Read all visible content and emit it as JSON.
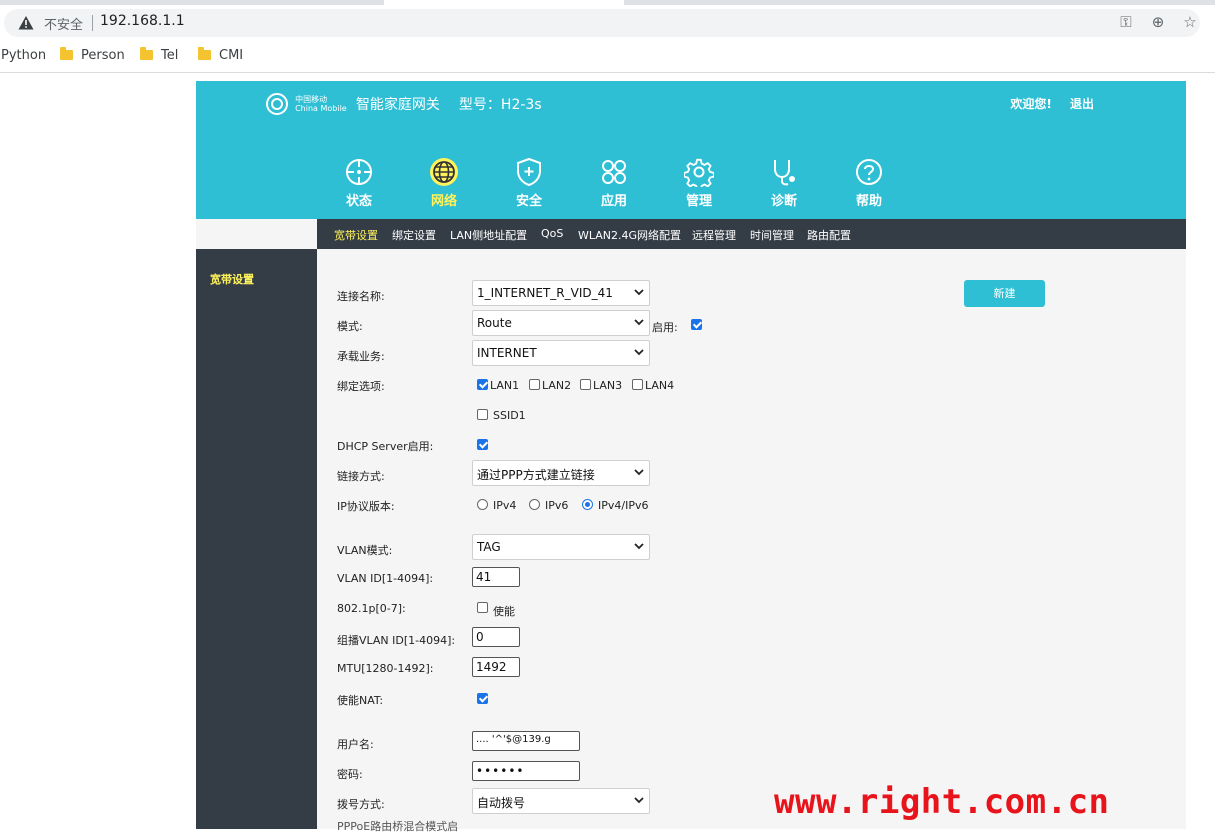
{
  "browser": {
    "security_label": "不安全",
    "url": "192.168.1.1",
    "bookmarks": [
      {
        "label": "Python",
        "folder": false
      },
      {
        "label": "Person",
        "folder": true
      },
      {
        "label": "Tel",
        "folder": true
      },
      {
        "label": "CMI",
        "folder": true
      }
    ]
  },
  "header": {
    "brand_cn": "中国移动",
    "brand_en": "China Mobile",
    "title": "智能家庭网关",
    "model": "型号：H2-3s",
    "welcome": "欢迎您!",
    "logout": "退出"
  },
  "nav": {
    "items": [
      {
        "label": "状态",
        "icon": "crosshair-icon"
      },
      {
        "label": "网络",
        "icon": "globe-icon"
      },
      {
        "label": "安全",
        "icon": "shield-icon"
      },
      {
        "label": "应用",
        "icon": "apps-icon"
      },
      {
        "label": "管理",
        "icon": "gear-icon"
      },
      {
        "label": "诊断",
        "icon": "stethoscope-icon"
      },
      {
        "label": "帮助",
        "icon": "help-icon"
      }
    ],
    "active": "网络"
  },
  "subnav": {
    "items": [
      "宽带设置",
      "绑定设置",
      "LAN侧地址配置",
      "QoS",
      "WLAN2.4G网络配置",
      "远程管理",
      "时间管理",
      "路由配置"
    ],
    "active": "宽带设置"
  },
  "sidebar": {
    "item": "宽带设置"
  },
  "form": {
    "new_button": "新建",
    "connection_name": {
      "label": "连接名称:",
      "value": "1_INTERNET_R_VID_41"
    },
    "mode": {
      "label": "模式:",
      "value": "Route",
      "enable_label": "启用:",
      "enabled": true
    },
    "service": {
      "label": "承载业务:",
      "value": "INTERNET"
    },
    "bind": {
      "label": "绑定选项:",
      "options": [
        {
          "label": "LAN1",
          "checked": true
        },
        {
          "label": "LAN2",
          "checked": false
        },
        {
          "label": "LAN3",
          "checked": false
        },
        {
          "label": "LAN4",
          "checked": false
        },
        {
          "label": "SSID1",
          "checked": false
        }
      ]
    },
    "dhcp": {
      "label": "DHCP Server启用:",
      "checked": true
    },
    "link_mode": {
      "label": "链接方式:",
      "value": "通过PPP方式建立链接"
    },
    "ip_version": {
      "label": "IP协议版本:",
      "options": [
        {
          "label": "IPv4",
          "selected": false
        },
        {
          "label": "IPv6",
          "selected": false
        },
        {
          "label": "IPv4/IPv6",
          "selected": true
        }
      ]
    },
    "vlan_mode": {
      "label": "VLAN模式:",
      "value": "TAG"
    },
    "vlan_id": {
      "label": "VLAN ID[1-4094]:",
      "value": "41"
    },
    "dot1p": {
      "label": "802.1p[0-7]:",
      "option": "使能",
      "checked": false
    },
    "mcast_vlan": {
      "label": "组播VLAN ID[1-4094]:",
      "value": "0"
    },
    "mtu": {
      "label": "MTU[1280-1492]:",
      "value": "1492"
    },
    "nat": {
      "label": "使能NAT:",
      "checked": true
    },
    "username": {
      "label": "用户名:",
      "value": "....  '^'$@139.g"
    },
    "password": {
      "label": "密码:",
      "value": "••••••"
    },
    "dial_mode": {
      "label": "拨号方式:",
      "value": "自动拨号"
    },
    "cutoff_label": "PPPoE路由桥混合模式启"
  },
  "watermark": "www.right.com.cn"
}
